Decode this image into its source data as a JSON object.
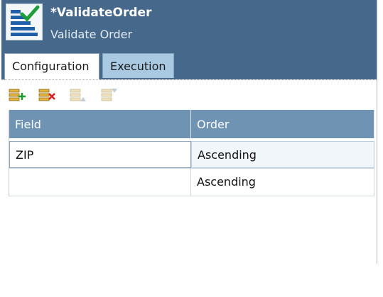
{
  "header": {
    "title": "*ValidateOrder",
    "subtitle": "Validate Order",
    "icon": "validate-list-check-icon"
  },
  "tabs": [
    {
      "label": "Configuration",
      "active": true
    },
    {
      "label": "Execution",
      "active": false
    }
  ],
  "toolbar": {
    "buttons": [
      {
        "icon": "add-row-icon",
        "enabled": true
      },
      {
        "icon": "delete-row-icon",
        "enabled": true
      },
      {
        "icon": "move-up-icon",
        "enabled": false
      },
      {
        "icon": "move-down-icon",
        "enabled": false
      }
    ]
  },
  "grid": {
    "columns": [
      "Field",
      "Order"
    ],
    "rows": [
      {
        "field": "ZIP",
        "order": "Ascending"
      },
      {
        "field": "",
        "order": "Ascending"
      }
    ]
  },
  "colors": {
    "header_bg": "#45688b",
    "inactive_tab": "#a9c8e2",
    "grid_header": "#6f93b3"
  }
}
